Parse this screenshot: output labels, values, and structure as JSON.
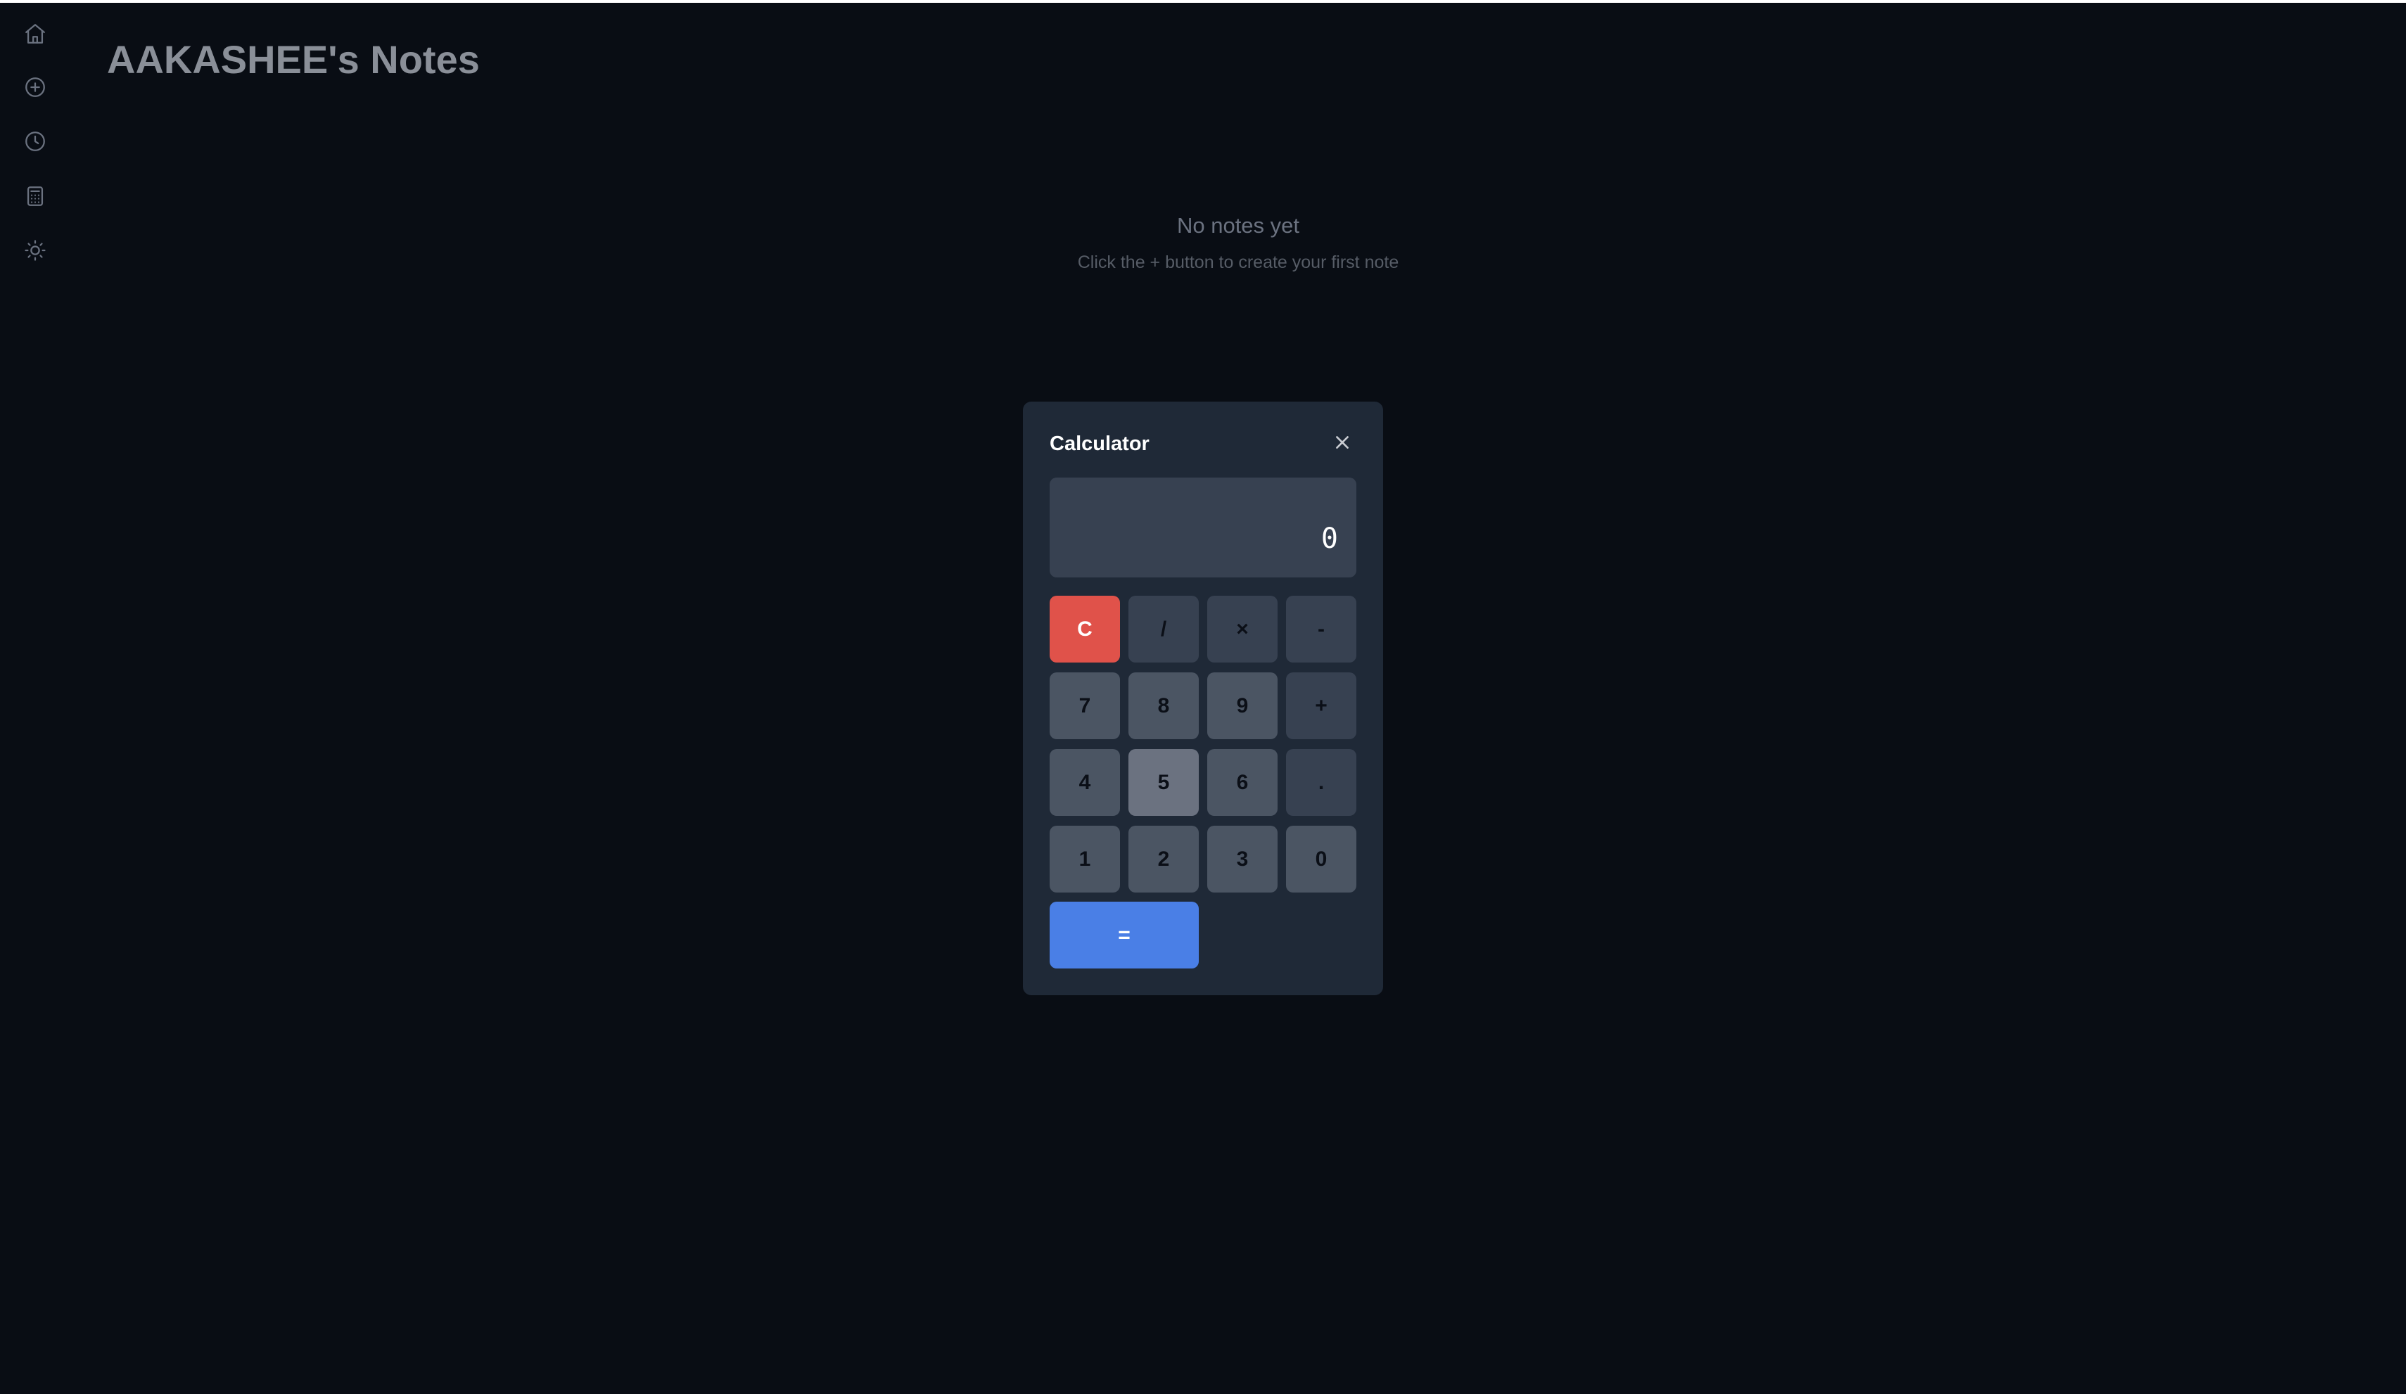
{
  "app": {
    "title": "AAKASHEE's Notes"
  },
  "sidebar": {
    "items": [
      {
        "icon": "home-icon",
        "label": "Home"
      },
      {
        "icon": "plus-circle-icon",
        "label": "New note"
      },
      {
        "icon": "clock-icon",
        "label": "History"
      },
      {
        "icon": "calculator-icon",
        "label": "Calculator"
      },
      {
        "icon": "sun-icon",
        "label": "Toggle theme"
      }
    ]
  },
  "empty_state": {
    "title": "No notes yet",
    "subtitle": "Click the + button to create your first note"
  },
  "calculator": {
    "title": "Calculator",
    "display": "0",
    "keys": {
      "clear": "C",
      "divide": "/",
      "multiply": "×",
      "subtract": "-",
      "seven": "7",
      "eight": "8",
      "nine": "9",
      "add": "+",
      "four": "4",
      "five": "5",
      "six": "6",
      "decimal": ".",
      "one": "1",
      "two": "2",
      "three": "3",
      "zero": "0",
      "equals": "="
    }
  },
  "colors": {
    "background": "#090d14",
    "modal": "#1f2937",
    "display": "#374151",
    "number_key": "#4b5563",
    "operator_key": "#374151",
    "clear_key": "#e0524a",
    "equals_key": "#4a7fe6"
  }
}
